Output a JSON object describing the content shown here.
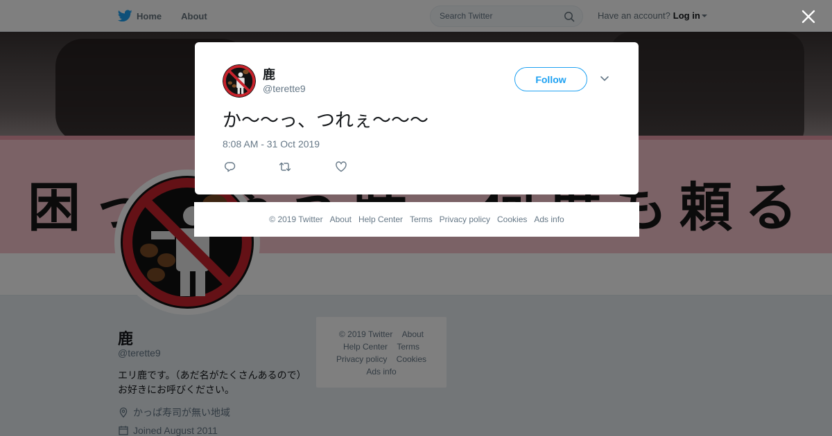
{
  "nav": {
    "home_label": "Home",
    "about_label": "About",
    "search_placeholder": "Search Twitter",
    "account_prompt": "Have an account?",
    "login_label": "Log in"
  },
  "banner": {
    "text": "困っちゃう時、何度も頼る"
  },
  "profile": {
    "name": "鹿",
    "handle": "@terette9",
    "bio": "エリ鹿です。（あだ名がたくさんあるので）お好きにお呼びください。",
    "location": "かっぱ寿司が無い地域",
    "joined": "Joined August 2011"
  },
  "side_footer": {
    "copyright": "© 2019 Twitter",
    "about": "About",
    "help": "Help Center",
    "terms": "Terms",
    "privacy": "Privacy policy",
    "cookies": "Cookies",
    "ads": "Ads info"
  },
  "tweet": {
    "name": "鹿",
    "handle": "@terette9",
    "follow_label": "Follow",
    "text": "か〜〜っ、つれぇ〜〜〜",
    "timestamp": "8:08 AM - 31 Oct 2019"
  },
  "modal_footer": {
    "copyright": "© 2019 Twitter",
    "about": "About",
    "help": "Help Center",
    "terms": "Terms",
    "privacy": "Privacy policy",
    "cookies": "Cookies",
    "ads": "Ads info"
  },
  "colors": {
    "twitter_blue": "#1da1f2",
    "secondary_text": "#657786",
    "overlay": "rgba(0,0,0,0.5)"
  },
  "icons": [
    "twitter-bird-icon",
    "search-icon",
    "close-icon",
    "chevron-down-icon",
    "reply-icon",
    "retweet-icon",
    "like-icon",
    "location-icon",
    "calendar-icon"
  ]
}
